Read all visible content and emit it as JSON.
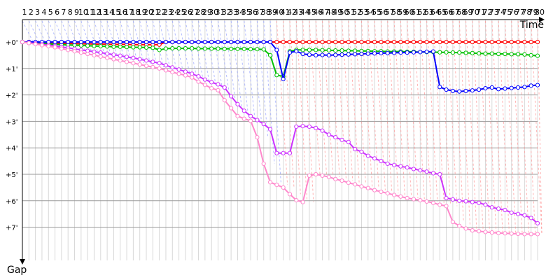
{
  "chart_data": {
    "type": "line",
    "xlabel": "Time",
    "ylabel": "Gap",
    "x": [
      1,
      2,
      3,
      4,
      5,
      6,
      7,
      8,
      9,
      10,
      11,
      12,
      13,
      14,
      15,
      16,
      17,
      18,
      19,
      20,
      21,
      22,
      23,
      24,
      25,
      26,
      27,
      28,
      29,
      30,
      31,
      32,
      33,
      34,
      35,
      36,
      37,
      38,
      39,
      40,
      41,
      42,
      43,
      44,
      45,
      46,
      47,
      48,
      49,
      50,
      51,
      52,
      53,
      54,
      55,
      56,
      57,
      58,
      59,
      60,
      61,
      62,
      63,
      64,
      65,
      66,
      67,
      68,
      69,
      70,
      71,
      72,
      73,
      74,
      75,
      76,
      77,
      78,
      79,
      80
    ],
    "xlim": [
      1,
      80
    ],
    "ylim": [
      0,
      8
    ],
    "y_ticks": [
      0,
      1,
      2,
      3,
      4,
      5,
      6,
      7
    ],
    "y_tick_labels": [
      "+0'",
      "+1'",
      "+2'",
      "+3'",
      "+4'",
      "+5'",
      "+6'",
      "+7'"
    ],
    "grid": true,
    "series": [
      {
        "color": "#ff0000",
        "values": [
          0,
          0,
          0.02,
          0.03,
          0.04,
          0.05,
          0.05,
          0.06,
          0.06,
          0.07,
          0.07,
          0.08,
          0.08,
          0.08,
          0.09,
          0.09,
          0.09,
          0.1,
          0.1,
          0.1,
          0.1,
          0.1,
          0,
          0,
          0,
          0,
          0,
          0,
          0,
          0,
          0,
          0,
          0,
          0,
          0,
          0,
          0,
          0,
          0,
          0,
          0,
          0,
          0,
          0,
          0,
          0,
          0,
          0,
          0,
          0,
          0,
          0,
          0,
          0,
          0,
          0,
          0,
          0,
          0,
          0,
          0,
          0,
          0,
          0,
          0,
          0,
          0,
          0,
          0,
          0,
          0,
          0,
          0,
          0,
          0,
          0,
          0,
          0,
          0,
          0
        ]
      },
      {
        "color": "#00c000",
        "values": [
          0,
          0.01,
          0.03,
          0.05,
          0.07,
          0.09,
          0.1,
          0.11,
          0.12,
          0.13,
          0.14,
          0.15,
          0.16,
          0.17,
          0.18,
          0.18,
          0.19,
          0.2,
          0.2,
          0.21,
          0.22,
          0.3,
          0.25,
          0.24,
          0.24,
          0.24,
          0.24,
          0.25,
          0.25,
          0.25,
          0.25,
          0.26,
          0.26,
          0.26,
          0.26,
          0.27,
          0.27,
          0.28,
          0.5,
          1.25,
          1.3,
          0.35,
          0.3,
          0.3,
          0.3,
          0.3,
          0.31,
          0.31,
          0.32,
          0.32,
          0.33,
          0.33,
          0.34,
          0.34,
          0.35,
          0.35,
          0.36,
          0.36,
          0.36,
          0.37,
          0.37,
          0.38,
          0.38,
          0.38,
          0.39,
          0.39,
          0.4,
          0.4,
          0.41,
          0.42,
          0.43,
          0.44,
          0.44,
          0.45,
          0.45,
          0.46,
          0.46,
          0.47,
          0.5,
          0.52
        ]
      },
      {
        "color": "#0000ff",
        "values": [
          0,
          0,
          0,
          0,
          0,
          0,
          0,
          0,
          0,
          0,
          0,
          0,
          0,
          0,
          0,
          0,
          0,
          0,
          0,
          0,
          0,
          0,
          0,
          0,
          0,
          0,
          0,
          0,
          0,
          0,
          0,
          0,
          0,
          0,
          0,
          0,
          0,
          0,
          0,
          0.3,
          1.4,
          0.4,
          0.35,
          0.45,
          0.48,
          0.5,
          0.49,
          0.5,
          0.49,
          0.48,
          0.47,
          0.46,
          0.45,
          0.44,
          0.43,
          0.42,
          0.42,
          0.41,
          0.4,
          0.4,
          0.39,
          0.38,
          0.37,
          0.36,
          1.7,
          1.8,
          1.85,
          1.87,
          1.85,
          1.83,
          1.8,
          1.75,
          1.72,
          1.78,
          1.76,
          1.74,
          1.72,
          1.7,
          1.65,
          1.63
        ]
      },
      {
        "color": "#cc33ff",
        "values": [
          0,
          0.03,
          0.06,
          0.09,
          0.12,
          0.15,
          0.19,
          0.22,
          0.26,
          0.3,
          0.33,
          0.37,
          0.4,
          0.44,
          0.48,
          0.52,
          0.56,
          0.6,
          0.65,
          0.7,
          0.75,
          0.8,
          0.88,
          0.96,
          1.04,
          1.12,
          1.2,
          1.3,
          1.42,
          1.52,
          1.6,
          1.72,
          2.05,
          2.35,
          2.6,
          2.8,
          2.95,
          3.1,
          3.3,
          4.2,
          4.2,
          4.2,
          3.2,
          3.18,
          3.2,
          3.25,
          3.35,
          3.5,
          3.6,
          3.7,
          3.78,
          4.05,
          4.15,
          4.3,
          4.4,
          4.5,
          4.6,
          4.65,
          4.7,
          4.74,
          4.8,
          4.85,
          4.9,
          4.96,
          5.0,
          5.9,
          5.95,
          6.0,
          6.02,
          6.05,
          6.08,
          6.15,
          6.25,
          6.3,
          6.35,
          6.45,
          6.5,
          6.55,
          6.65,
          6.85
        ]
      },
      {
        "color": "#ff88cc",
        "values": [
          0,
          0.04,
          0.08,
          0.12,
          0.16,
          0.2,
          0.25,
          0.3,
          0.35,
          0.4,
          0.45,
          0.5,
          0.55,
          0.6,
          0.65,
          0.7,
          0.75,
          0.8,
          0.85,
          0.9,
          0.95,
          1.0,
          1.07,
          1.14,
          1.2,
          1.26,
          1.34,
          1.5,
          1.62,
          1.75,
          1.82,
          2.2,
          2.5,
          2.8,
          2.9,
          2.98,
          3.6,
          4.6,
          5.3,
          5.4,
          5.5,
          5.75,
          5.98,
          6.05,
          5.05,
          5.0,
          5.05,
          5.1,
          5.18,
          5.24,
          5.32,
          5.38,
          5.46,
          5.52,
          5.6,
          5.66,
          5.72,
          5.78,
          5.84,
          5.9,
          5.94,
          5.98,
          6.03,
          6.08,
          6.15,
          6.2,
          6.8,
          6.95,
          7.05,
          7.12,
          7.15,
          7.18,
          7.2,
          7.22,
          7.23,
          7.24,
          7.25,
          7.26,
          7.26,
          7.26
        ]
      }
    ]
  }
}
